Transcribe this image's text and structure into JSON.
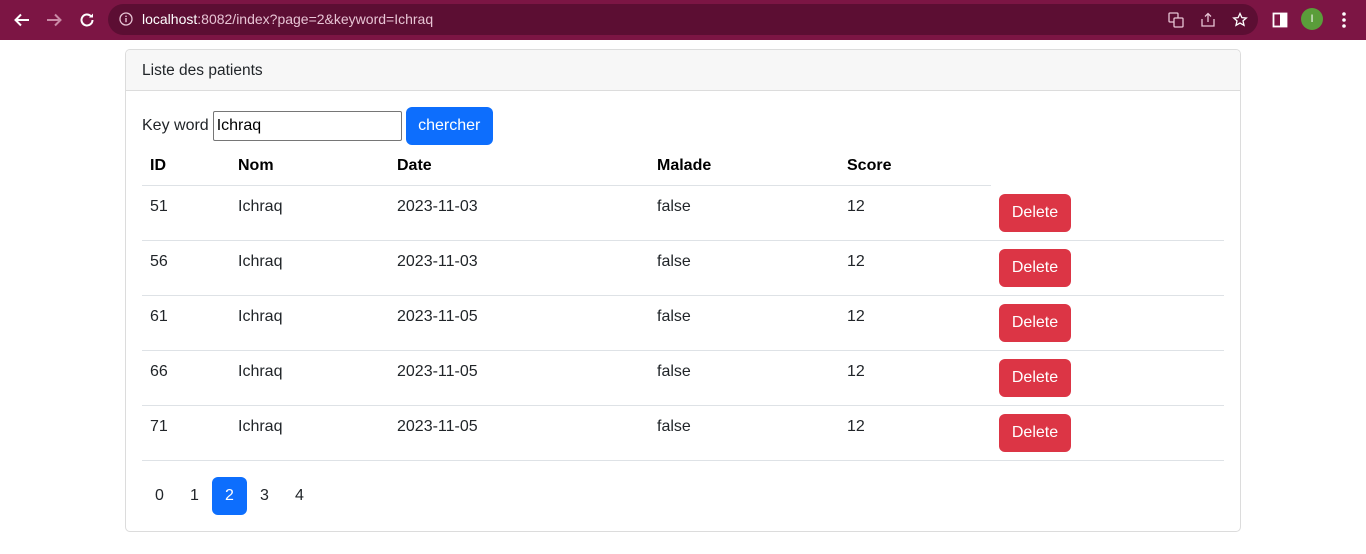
{
  "browser": {
    "url_host": "localhost",
    "url_rest": ":8082/index?page=2&keyword=Ichraq",
    "avatar_letter": "I"
  },
  "card": {
    "title": "Liste des patients"
  },
  "search": {
    "label": "Key word",
    "value": "Ichraq",
    "button_label": "chercher"
  },
  "table": {
    "headers": [
      "ID",
      "Nom",
      "Date",
      "Malade",
      "Score"
    ],
    "rows": [
      {
        "id": "51",
        "nom": "Ichraq",
        "date": "2023-11-03",
        "malade": "false",
        "score": "12",
        "action": "Delete"
      },
      {
        "id": "56",
        "nom": "Ichraq",
        "date": "2023-11-03",
        "malade": "false",
        "score": "12",
        "action": "Delete"
      },
      {
        "id": "61",
        "nom": "Ichraq",
        "date": "2023-11-05",
        "malade": "false",
        "score": "12",
        "action": "Delete"
      },
      {
        "id": "66",
        "nom": "Ichraq",
        "date": "2023-11-05",
        "malade": "false",
        "score": "12",
        "action": "Delete"
      },
      {
        "id": "71",
        "nom": "Ichraq",
        "date": "2023-11-05",
        "malade": "false",
        "score": "12",
        "action": "Delete"
      }
    ]
  },
  "pagination": {
    "pages": [
      "0",
      "1",
      "2",
      "3",
      "4"
    ],
    "current": "2"
  },
  "colors": {
    "browser_bar": "#7c1544",
    "primary": "#0d6efd",
    "danger": "#dc3545"
  }
}
